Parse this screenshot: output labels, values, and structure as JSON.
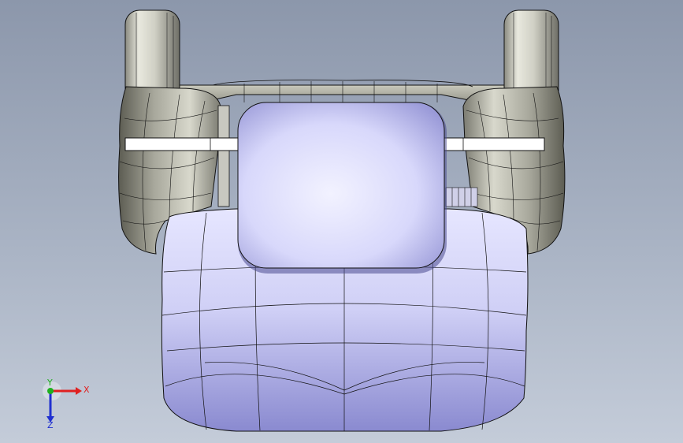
{
  "viewport": {
    "background_top": "#8c97ab",
    "background_bottom": "#c4ccd9"
  },
  "model": {
    "body_color": "#c9c9f4",
    "body_shadow": "#6b6bb0",
    "wheel_color": "#d2d2c8",
    "wheel_shadow": "#5a5a52",
    "edge_color": "#111111",
    "wing_color": "#ffffff"
  },
  "triad": {
    "x_label": "X",
    "y_label": "Y",
    "z_label": "Z",
    "x_color": "#e02020",
    "y_color": "#20b020",
    "z_color": "#2030d0"
  }
}
